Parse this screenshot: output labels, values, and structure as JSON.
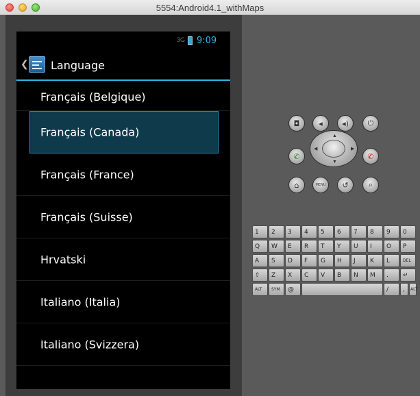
{
  "window": {
    "title": "5554:Android4.1_withMaps"
  },
  "status_bar": {
    "signal": "3G",
    "time": "9:09"
  },
  "action_bar": {
    "title": "Language"
  },
  "languages": [
    "Français (Belgique)",
    "Français (Canada)",
    "Français (France)",
    "Français (Suisse)",
    "Hrvatski",
    "Italiano (Italia)",
    "Italiano (Svizzera)"
  ],
  "selected_language": "Français (Canada)",
  "controls": {
    "camera": "camera-icon",
    "volume_down": "volume-down-icon",
    "volume_up": "volume-up-icon",
    "power": "power-icon",
    "call": "call-icon",
    "end_call": "end-call-icon",
    "home": "home-icon",
    "menu_label": "MENU",
    "back": "back-icon",
    "search": "search-icon"
  },
  "keyboard": {
    "row1": [
      "1",
      "2",
      "3",
      "4",
      "5",
      "6",
      "7",
      "8",
      "9",
      "0"
    ],
    "row2": [
      "Q",
      "W",
      "E",
      "R",
      "T",
      "Y",
      "U",
      "I",
      "O",
      "P"
    ],
    "row3": [
      "A",
      "S",
      "D",
      "F",
      "G",
      "H",
      "J",
      "K",
      "L",
      "DEL"
    ],
    "row4": [
      "⇧",
      "Z",
      "X",
      "C",
      "V",
      "B",
      "N",
      "M",
      ".",
      "↵"
    ],
    "row5": [
      "ALT",
      "SYM",
      "@",
      "",
      "/",
      ",",
      "ALT"
    ]
  },
  "colors": {
    "accent": "#33b5e5",
    "selection_bg": "#0f3a4c",
    "screen_bg": "#000000",
    "emulator_bg": "#5a5a5a"
  }
}
